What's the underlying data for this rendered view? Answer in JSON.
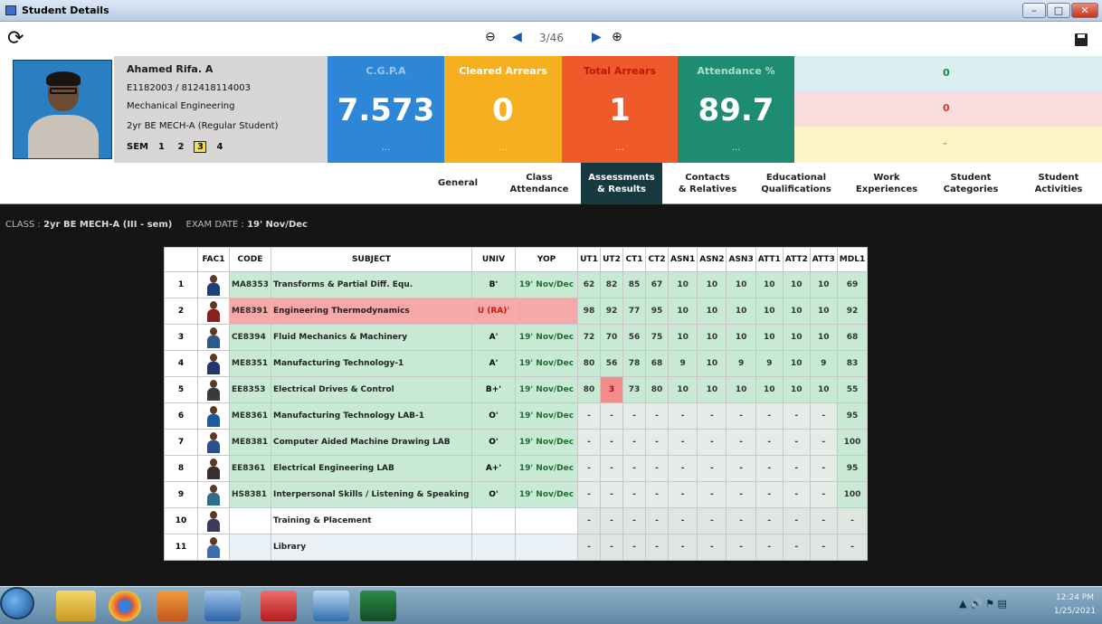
{
  "window": {
    "title": "Student Details"
  },
  "nav": {
    "count": "3/46"
  },
  "student": {
    "name": "Ahamed Rifa. A",
    "reg": "E1182003 / 812418114003",
    "department": "Mechanical Engineering",
    "class": "2yr BE MECH-A (Regular Student)",
    "sem_label": "SEM",
    "sems": [
      "1",
      "2",
      "3",
      "4"
    ],
    "active_sem": "3"
  },
  "tiles": {
    "cgpa": {
      "label": "C.G.P.A",
      "value": "7.573",
      "dots": "..."
    },
    "cleared": {
      "label": "Cleared Arrears",
      "value": "0",
      "dots": "..."
    },
    "total": {
      "label": "Total Arrears",
      "value": "1",
      "dots": "..."
    },
    "attendance": {
      "label": "Attendance %",
      "value": "89.7",
      "dots": "..."
    }
  },
  "side": {
    "r1": "0",
    "r2": "0",
    "r3": "-"
  },
  "colors": {
    "cgpa": "#2e86d6",
    "cleared": "#f6b01f",
    "total": "#ef5a2b",
    "attendance": "#1e8c73",
    "active_tab": "#163a40"
  },
  "tabs": [
    {
      "l1": "General",
      "l2": ""
    },
    {
      "l1": "Class",
      "l2": "Attendance"
    },
    {
      "l1": "Assessments",
      "l2": "& Results"
    },
    {
      "l1": "Contacts",
      "l2": "& Relatives"
    },
    {
      "l1": "Educational",
      "l2": "Qualifications"
    },
    {
      "l1": "Work",
      "l2": "Experiences"
    },
    {
      "l1": "Student",
      "l2": "Categories"
    },
    {
      "l1": "Student",
      "l2": "Activities"
    }
  ],
  "classline": {
    "class_label": "CLASS",
    "class_value": "2yr BE MECH-A (III - sem)",
    "exam_label": "EXAM DATE",
    "exam_value": "19' Nov/Dec"
  },
  "table": {
    "headers": [
      "",
      "FAC1",
      "CODE",
      "SUBJECT",
      "UNIV",
      "YOP",
      "UT1",
      "UT2",
      "CT1",
      "CT2",
      "ASN1",
      "ASN2",
      "ASN3",
      "ATT1",
      "ATT2",
      "ATT3",
      "MDL1"
    ],
    "rows": [
      {
        "sno": "1",
        "code": "MA8353",
        "subject": "Transforms & Partial Diff. Equ.",
        "univ": "B'",
        "yop": "19' Nov/Dec",
        "marks": [
          "62",
          "82",
          "85",
          "67",
          "10",
          "10",
          "10",
          "10",
          "10",
          "10",
          "69"
        ]
      },
      {
        "sno": "2",
        "code": "ME8391",
        "subject": "Engineering Thermodynamics",
        "univ": "U (RA)'",
        "yop": "",
        "marks": [
          "98",
          "92",
          "77",
          "95",
          "10",
          "10",
          "10",
          "10",
          "10",
          "10",
          "92"
        ]
      },
      {
        "sno": "3",
        "code": "CE8394",
        "subject": "Fluid Mechanics & Machinery",
        "univ": "A'",
        "yop": "19' Nov/Dec",
        "marks": [
          "72",
          "70",
          "56",
          "75",
          "10",
          "10",
          "10",
          "10",
          "10",
          "10",
          "68"
        ]
      },
      {
        "sno": "4",
        "code": "ME8351",
        "subject": "Manufacturing Technology-1",
        "univ": "A'",
        "yop": "19' Nov/Dec",
        "marks": [
          "80",
          "56",
          "78",
          "68",
          "9",
          "10",
          "9",
          "9",
          "10",
          "9",
          "83"
        ]
      },
      {
        "sno": "5",
        "code": "EE8353",
        "subject": "Electrical Drives & Control",
        "univ": "B+'",
        "yop": "19' Nov/Dec",
        "marks": [
          "80",
          "3",
          "73",
          "80",
          "10",
          "10",
          "10",
          "10",
          "10",
          "10",
          "55"
        ]
      },
      {
        "sno": "6",
        "code": "ME8361",
        "subject": "Manufacturing Technology LAB-1",
        "univ": "O'",
        "yop": "19' Nov/Dec",
        "marks": [
          "-",
          "-",
          "-",
          "-",
          "-",
          "-",
          "-",
          "-",
          "-",
          "-",
          "95"
        ]
      },
      {
        "sno": "7",
        "code": "ME8381",
        "subject": "Computer Aided Machine Drawing LAB",
        "univ": "O'",
        "yop": "19' Nov/Dec",
        "marks": [
          "-",
          "-",
          "-",
          "-",
          "-",
          "-",
          "-",
          "-",
          "-",
          "-",
          "100"
        ]
      },
      {
        "sno": "8",
        "code": "EE8361",
        "subject": "Electrical Engineering LAB",
        "univ": "A+'",
        "yop": "19' Nov/Dec",
        "marks": [
          "-",
          "-",
          "-",
          "-",
          "-",
          "-",
          "-",
          "-",
          "-",
          "-",
          "95"
        ]
      },
      {
        "sno": "9",
        "code": "HS8381",
        "subject": "Interpersonal Skills / Listening & Speaking",
        "univ": "O'",
        "yop": "19' Nov/Dec",
        "marks": [
          "-",
          "-",
          "-",
          "-",
          "-",
          "-",
          "-",
          "-",
          "-",
          "-",
          "100"
        ]
      },
      {
        "sno": "10",
        "code": "",
        "subject": "Training & Placement",
        "univ": "",
        "yop": "",
        "marks": [
          "-",
          "-",
          "-",
          "-",
          "-",
          "-",
          "-",
          "-",
          "-",
          "-",
          "-"
        ]
      },
      {
        "sno": "11",
        "code": "",
        "subject": "Library",
        "univ": "",
        "yop": "",
        "marks": [
          "-",
          "-",
          "-",
          "-",
          "-",
          "-",
          "-",
          "-",
          "-",
          "-",
          "-"
        ]
      }
    ]
  },
  "taskbar": {
    "time": "12:24 PM",
    "date": "1/25/2021"
  }
}
